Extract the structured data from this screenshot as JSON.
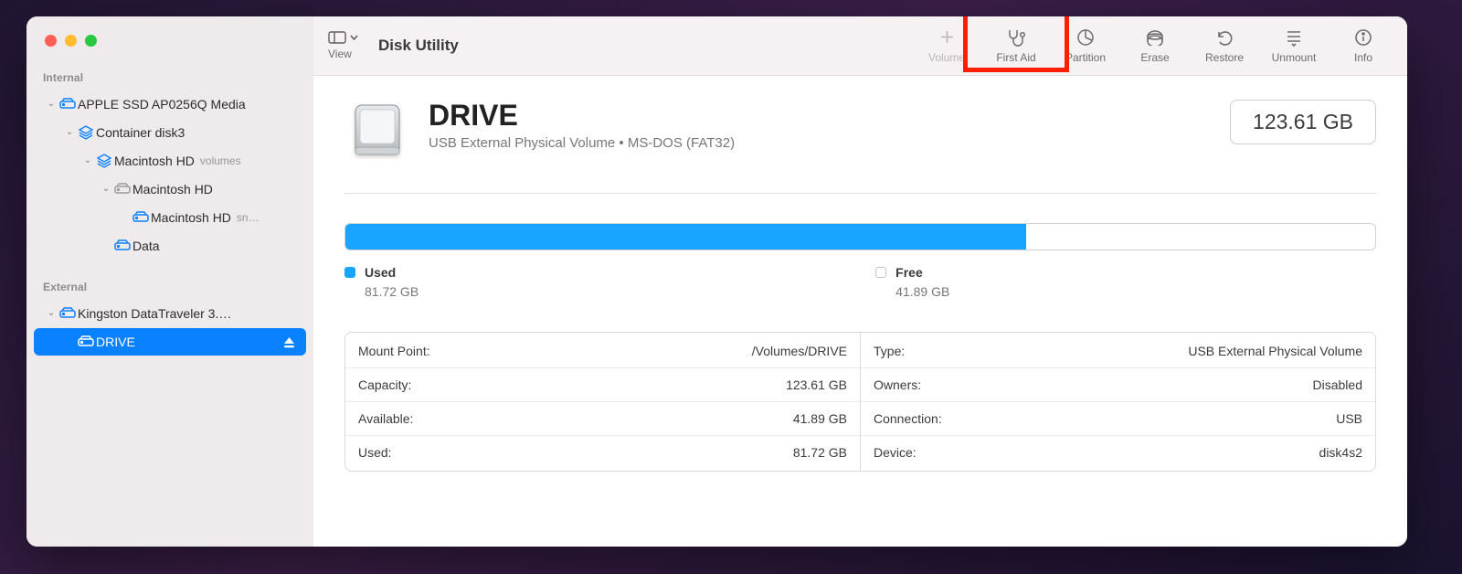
{
  "app_title": "Disk Utility",
  "toolbar": {
    "view_label": "View",
    "buttons": [
      {
        "id": "volume",
        "label": "Volume",
        "icon": "plus",
        "disabled": true
      },
      {
        "id": "first-aid",
        "label": "First Aid",
        "icon": "stethoscope",
        "disabled": false
      },
      {
        "id": "partition",
        "label": "Partition",
        "icon": "pie",
        "disabled": false
      },
      {
        "id": "erase",
        "label": "Erase",
        "icon": "eraser",
        "disabled": false
      },
      {
        "id": "restore",
        "label": "Restore",
        "icon": "undo",
        "disabled": false
      },
      {
        "id": "unmount",
        "label": "Unmount",
        "icon": "unmount",
        "disabled": false
      },
      {
        "id": "info",
        "label": "Info",
        "icon": "info",
        "disabled": false
      }
    ]
  },
  "sidebar": {
    "internal_label": "Internal",
    "external_label": "External",
    "internal": [
      {
        "indent": 0,
        "chevron": "down",
        "icon": "hdd",
        "label": "APPLE SSD AP0256Q Media"
      },
      {
        "indent": 1,
        "chevron": "down",
        "icon": "stack",
        "label": "Container disk3"
      },
      {
        "indent": 2,
        "chevron": "down",
        "icon": "stack",
        "label": "Macintosh HD",
        "suffix": "volumes"
      },
      {
        "indent": 3,
        "chevron": "down",
        "icon": "hdd-gray",
        "label": "Macintosh HD"
      },
      {
        "indent": 4,
        "chevron": "",
        "icon": "hdd",
        "label": "Macintosh HD",
        "suffix": "sn…"
      },
      {
        "indent": 3,
        "chevron": "",
        "icon": "hdd",
        "label": "Data"
      }
    ],
    "external": [
      {
        "indent": 0,
        "chevron": "down",
        "icon": "hdd",
        "label": "Kingston DataTraveler 3.…"
      },
      {
        "indent": 1,
        "chevron": "",
        "icon": "hdd",
        "label": "DRIVE",
        "selected": true,
        "eject": true
      }
    ]
  },
  "drive": {
    "name": "DRIVE",
    "subtitle": "USB External Physical Volume • MS-DOS (FAT32)",
    "capacity": "123.61 GB",
    "usage_percent": 66.1,
    "legend": {
      "used_label": "Used",
      "used_val": "81.72 GB",
      "free_label": "Free",
      "free_val": "41.89 GB"
    },
    "details_left": [
      {
        "k": "Mount Point:",
        "v": "/Volumes/DRIVE"
      },
      {
        "k": "Capacity:",
        "v": "123.61 GB"
      },
      {
        "k": "Available:",
        "v": "41.89 GB"
      },
      {
        "k": "Used:",
        "v": "81.72 GB"
      }
    ],
    "details_right": [
      {
        "k": "Type:",
        "v": "USB External Physical Volume"
      },
      {
        "k": "Owners:",
        "v": "Disabled"
      },
      {
        "k": "Connection:",
        "v": "USB"
      },
      {
        "k": "Device:",
        "v": "disk4s2"
      }
    ]
  },
  "highlight": {
    "target": "first-aid"
  }
}
